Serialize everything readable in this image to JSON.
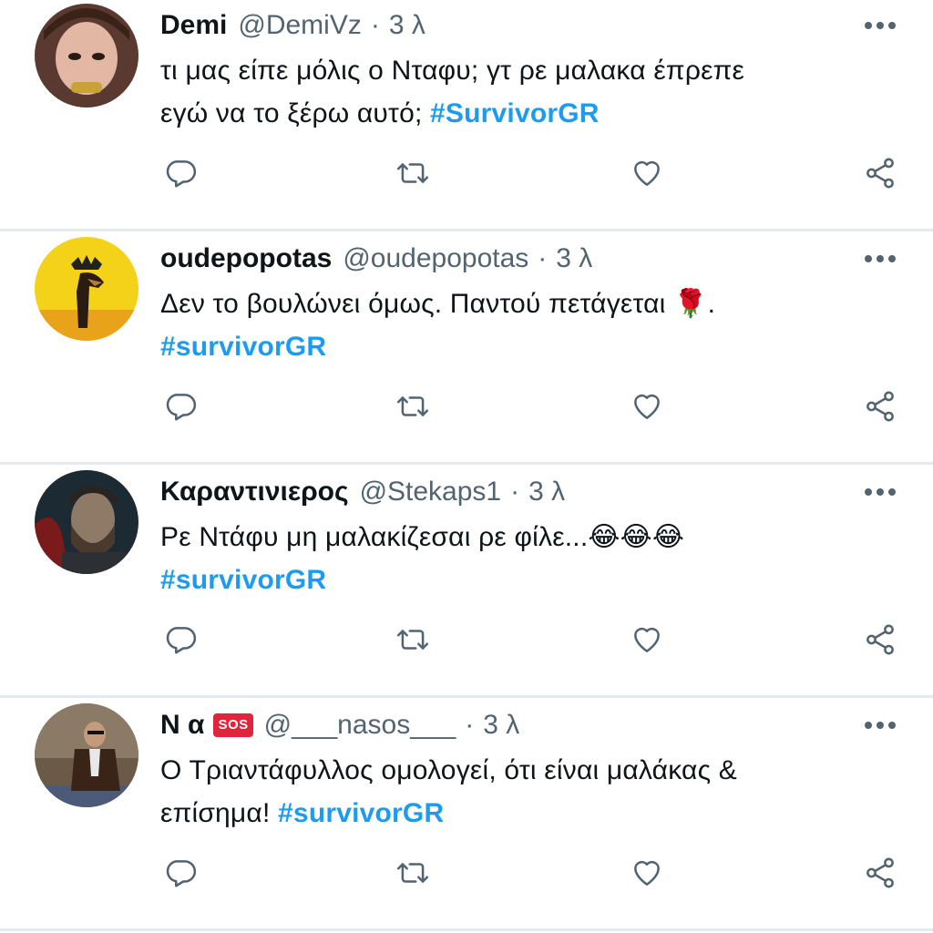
{
  "colors": {
    "text": "#0f1419",
    "secondary": "#536471",
    "hashtag": "#1d9bf0",
    "divider": "#e7eaed",
    "sos_badge": "#e0243b"
  },
  "icons": {
    "reply": "reply-icon",
    "retweet": "retweet-icon",
    "like": "heart-icon",
    "share": "share-icon",
    "more": "more-options-icon"
  },
  "tweets": [
    {
      "display_name": "Demi",
      "handle": "@DemiVz",
      "separator": "·",
      "time": "3 λ",
      "text_line1": "τι μας είπε μόλις ο Νταφυ; γτ ρε μαλακα έπρεπε",
      "text_line2": "εγώ να το ξέρω αυτό; ",
      "hashtag": "#SurvivorGR"
    },
    {
      "display_name": "oudepopotas",
      "handle": "@oudepopotas",
      "separator": "·",
      "time": "3 λ",
      "text_line1": "Δεν το βουλώνει όμως. Παντού πετάγεται ",
      "emoji": "🌹",
      "text_line1_end": ".",
      "hashtag": "#survivorGR"
    },
    {
      "display_name": "Καραντινιερος",
      "handle": "@Stekaps1",
      "separator": "·",
      "time": "3 λ",
      "text_line1": "Ρε Ντάφυ μη μαλακίζεσαι ρε φίλε...",
      "emoji": "😂😂😂",
      "hashtag": "#survivorGR"
    },
    {
      "display_name": "Ν α",
      "badge": "SOS",
      "handle": "@___nasos___",
      "separator": "·",
      "time": "3 λ",
      "text_line1": "Ο Τριαντάφυλλος ομολογεί, ότι είναι μαλάκας &",
      "text_line2": "επίσημα! ",
      "hashtag": "#survivorGR"
    }
  ]
}
